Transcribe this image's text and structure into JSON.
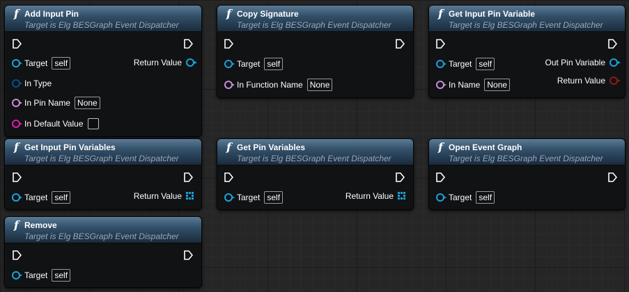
{
  "colors": {
    "object_pin": "#1aa3d9",
    "name_pin": "#c98ed6",
    "string_pin": "#e21ba7",
    "bool_pin": "#8f1a1a",
    "byte_pin": "#0b4d8a"
  },
  "nodes": [
    {
      "title": "Add Input Pin",
      "subtitle": "Target is Elg BESGraph Event Dispatcher",
      "inputs": [
        {
          "label": "Target",
          "value": "self",
          "pin": "object"
        },
        {
          "label": "In Type",
          "value": "",
          "pin": "byte"
        },
        {
          "label": "In Pin Name",
          "value": "None",
          "pin": "name"
        },
        {
          "label": "In Default Value",
          "value": "",
          "pin": "string"
        }
      ],
      "outputs": [
        {
          "label": "Return Value",
          "pin": "object"
        }
      ]
    },
    {
      "title": "Copy Signature",
      "subtitle": "Target is Elg BESGraph Event Dispatcher",
      "inputs": [
        {
          "label": "Target",
          "value": "self",
          "pin": "object"
        },
        {
          "label": "In Function Name",
          "value": "None",
          "pin": "name"
        }
      ],
      "outputs": []
    },
    {
      "title": "Get Input Pin Variable",
      "subtitle": "Target is Elg BESGraph Event Dispatcher",
      "inputs": [
        {
          "label": "Target",
          "value": "self",
          "pin": "object"
        },
        {
          "label": "In Name",
          "value": "None",
          "pin": "name"
        }
      ],
      "outputs": [
        {
          "label": "Out Pin Variable",
          "pin": "object"
        },
        {
          "label": "Return Value",
          "pin": "bool"
        }
      ]
    },
    {
      "title": "Get Input Pin Variables",
      "subtitle": "Target is Elg BESGraph Event Dispatcher",
      "inputs": [
        {
          "label": "Target",
          "value": "self",
          "pin": "object"
        }
      ],
      "outputs": [
        {
          "label": "Return Value",
          "pin": "array"
        }
      ]
    },
    {
      "title": "Get Pin Variables",
      "subtitle": "Target is Elg BESGraph Event Dispatcher",
      "inputs": [
        {
          "label": "Target",
          "value": "self",
          "pin": "object"
        }
      ],
      "outputs": [
        {
          "label": "Return Value",
          "pin": "array"
        }
      ]
    },
    {
      "title": "Open Event Graph",
      "subtitle": "Target is Elg BESGraph Event Dispatcher",
      "inputs": [
        {
          "label": "Target",
          "value": "self",
          "pin": "object"
        }
      ],
      "outputs": []
    },
    {
      "title": "Remove",
      "subtitle": "Target is Elg BESGraph Event Dispatcher",
      "inputs": [
        {
          "label": "Target",
          "value": "self",
          "pin": "object"
        }
      ],
      "outputs": []
    }
  ]
}
